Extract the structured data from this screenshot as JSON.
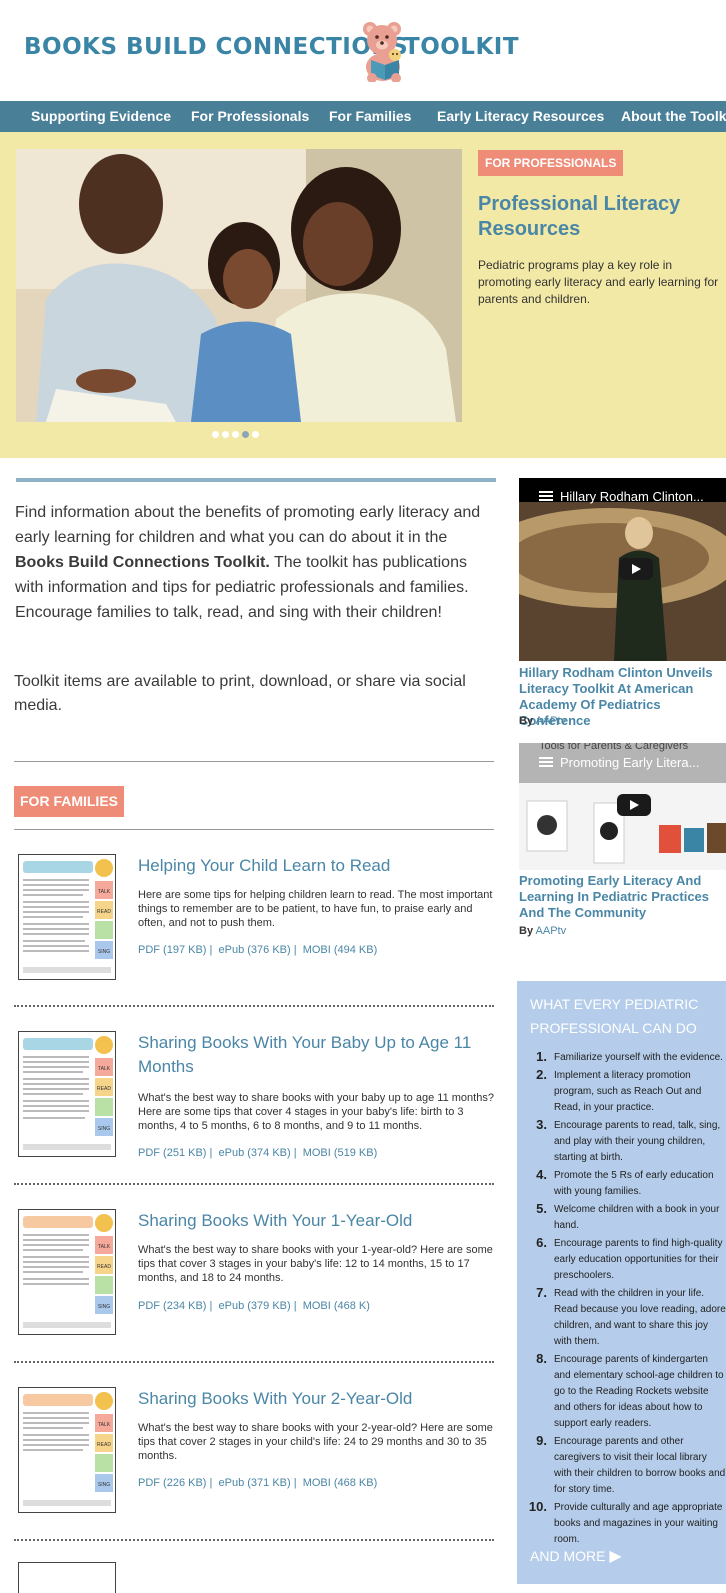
{
  "header": {
    "logo_text": "BOOKS BUILD CONNECTIONS",
    "logo_text2": "TOOLKIT"
  },
  "nav": [
    "Supporting Evidence",
    "For Professionals",
    "For Families",
    "Early Literacy Resources",
    "About the Toolkit"
  ],
  "hero": {
    "badge": "FOR PROFESSIONALS",
    "title": "Professional Literacy Resources",
    "description": "Pediatric programs play a key role in promoting early literacy and early learning for parents and children.",
    "active_slide": 4,
    "slide_count": 5
  },
  "intro": {
    "p1_before": "Find information about the benefits of promoting early literacy and early learning for children and what you can do about it in the ",
    "p1_bold": "Books Build Connections Toolkit.",
    "p1_after": " The toolkit has publications with information and tips for pediatric professionals and families. Encourage families to talk, read, and sing with their children!",
    "p2": "Toolkit items are available to print, download, or share via social media."
  },
  "families": {
    "badge": "FOR FAMILIES",
    "items": [
      {
        "title": "Helping Your Child Learn to Read",
        "description": "Here are some tips for helping children learn to read. The most important things to remember are to be patient, to have fun, to praise early and often, and not to push them.",
        "links": [
          "PDF (197 KB)",
          "ePub (376 KB)",
          "MOBI (494 KB)"
        ]
      },
      {
        "title": "Sharing Books With Your Baby Up to Age 11 Months",
        "description": "What's the best way to share books with your baby up to age 11 months? Here are some tips that cover 4 stages in your baby's life: birth to 3 months, 4 to 5 months, 6 to 8 months, and 9 to 11 months.",
        "links": [
          "PDF (251 KB)",
          "ePub (374 KB)",
          "MOBI (519 KB)"
        ]
      },
      {
        "title": "Sharing Books With Your 1-Year-Old",
        "description": "What's the best way to share books with your 1-year-old? Here are some tips that cover 3 stages in your baby's life: 12 to 14 months, 15 to 17 months, and 18 to 24 months.",
        "links": [
          "PDF (234 KB)",
          "ePub (379 KB)",
          "MOBI (468 K)"
        ]
      },
      {
        "title": "Sharing Books With Your 2-Year-Old",
        "description": "What's the best way to share books with your 2-year-old? Here are some tips that cover 2 stages in your child's life: 24 to 29 months and 30 to 35 months.",
        "links": [
          "PDF (226 KB)",
          "ePub (371 KB)",
          "MOBI (468 KB)"
        ]
      }
    ],
    "thumb_labels": [
      "TALK",
      "READ",
      "SING"
    ]
  },
  "videos": [
    {
      "overlay_title": "Hillary Rodham Clinton...",
      "caption": "Hillary Rodham Clinton Unveils Literacy Toolkit At American Academy Of Pediatrics Conference",
      "by_label": "By",
      "author": "AAPtv"
    },
    {
      "overlay_title": "Promoting Early Litera...",
      "overlay_subtitle": "Tools for Parents & Caregivers",
      "caption": "Promoting Early Literacy And Learning In Pediatric Practices And The Community",
      "by_label": "By",
      "author": "AAPtv"
    }
  ],
  "sidebar": {
    "title": "WHAT EVERY PEDIATRIC PROFESSIONAL CAN DO",
    "items": [
      "Familiarize yourself with the evidence.",
      "Implement a literacy promotion program, such as Reach Out and Read, in your practice.",
      "Encourage parents to read, talk, sing, and play with their young children, starting at birth.",
      "Promote the 5 Rs of early education with young families.",
      "Welcome children with a book in your hand.",
      "Encourage parents to find high-quality early education opportunities for their preschoolers.",
      "Read with the children in your life. Read because you love reading, adore children, and want to share this joy with them.",
      "Encourage parents of kindergarten and elementary school-age children to go to the Reading Rockets website and others for ideas about how to support early readers.",
      "Encourage parents and other caregivers to visit their local library with their children to borrow books and for story time.",
      "Provide culturally and age appropriate books and magazines in your waiting room."
    ],
    "more": "AND MORE"
  },
  "colors": {
    "brand_blue": "#3a84a5",
    "nav_bg": "#4a7f98",
    "hero_bg": "#f3e9a7",
    "badge_salmon": "#ef8c78",
    "sidebar_bg": "#b5cdea"
  }
}
